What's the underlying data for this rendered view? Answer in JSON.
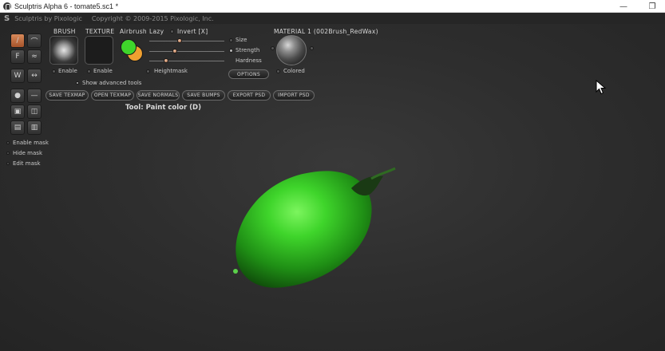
{
  "window": {
    "title": "Sculptris Alpha 6 - tomate5.sc1 *",
    "minimize_glyph": "—",
    "restore_glyph": "❐"
  },
  "menu_strip": {
    "logo": "S",
    "app_name": "Sculptris by Pixologic",
    "copyright": "Copyright © 2009-2015 Pixologic, Inc."
  },
  "panel": {
    "brush_label": "BRUSH",
    "texture_label": "TEXTURE",
    "airbrush_label": "Airbrush",
    "lazy_label": "Lazy",
    "invert_label": "Invert [X]",
    "size_label": "Size",
    "strength_label": "Strength",
    "hardness_label": "Hardness",
    "material_label": "MATERIAL 1 (002Brush_RedWax)",
    "brush_enable": "Enable",
    "texture_enable": "Enable",
    "heightmask_label": "Heightmask",
    "options_button": "OPTIONS",
    "colored_label": "Colored",
    "show_advanced": "Show advanced tools",
    "buttons": [
      "SAVE TEXMAP",
      "OPEN TEXMAP",
      "SAVE NORMALS",
      "SAVE BUMPS",
      "EXPORT PSD",
      "IMPORT PSD"
    ],
    "tool_text": "Tool: Paint color (D)",
    "sliders": {
      "size": 0.4,
      "strength": 0.33,
      "hardness": 0.2
    }
  },
  "mask": {
    "enable": "Enable mask",
    "hide": "Hide mask",
    "edit": "Edit mask"
  },
  "colors": {
    "primary_paint": "#3fd52b",
    "secondary_paint": "#f0a030",
    "viewport_bg": "#2e2e2e",
    "active_tool": "#c06a3a"
  },
  "icons": {
    "app": "sculptris-logo-icon",
    "cursor": "mouse-pointer-icon"
  }
}
